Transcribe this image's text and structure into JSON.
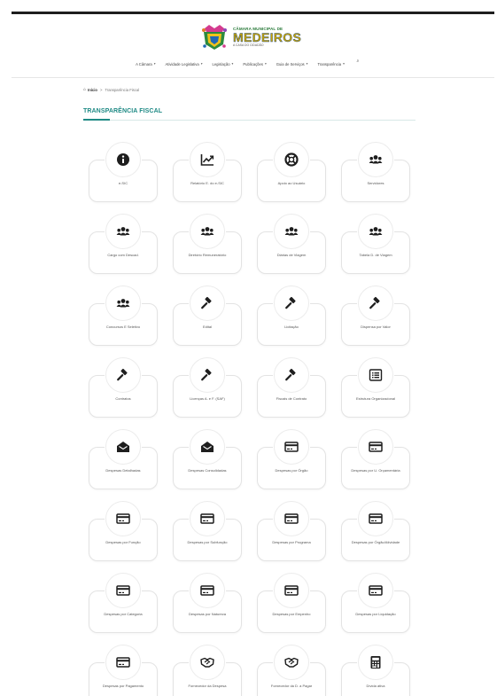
{
  "header": {
    "logo": {
      "subtitle": "CÂMARA MUNICIPAL DE",
      "name": "MEDEIROS",
      "tagline": "A CASA DO CIDADÃO"
    }
  },
  "nav": {
    "items": [
      {
        "label": "A Câmara"
      },
      {
        "label": "Atividade Legislativa"
      },
      {
        "label": "Legislação"
      },
      {
        "label": "Publicações"
      },
      {
        "label": "Guia de Serviços"
      },
      {
        "label": "Transparência"
      }
    ]
  },
  "breadcrumb": {
    "home": "Início",
    "separator": ">",
    "current": "Transparência Fiscal"
  },
  "section": {
    "title": "TRANSPARÊNCIA FISCAL"
  },
  "colors": {
    "accent": "#1f8a85",
    "icon": "#1e1e1e"
  },
  "cards": [
    {
      "label": "e-SIC",
      "icon": "info-icon"
    },
    {
      "label": "Relatório E. do e-SIC",
      "icon": "chart-line-icon"
    },
    {
      "label": "Apoio ao Usuário",
      "icon": "life-ring-icon"
    },
    {
      "label": "Servidores",
      "icon": "users-icon"
    },
    {
      "label": "Cargo com Descad.",
      "icon": "users-icon"
    },
    {
      "label": "Diretório Remuneratório",
      "icon": "users-icon"
    },
    {
      "label": "Diárias de Viagem",
      "icon": "users-icon"
    },
    {
      "label": "Tabela D. de Viagem",
      "icon": "users-icon"
    },
    {
      "label": "Concursos E Seletivo",
      "icon": "users-icon"
    },
    {
      "label": "Edital",
      "icon": "gavel-icon"
    },
    {
      "label": "Licitação",
      "icon": "gavel-icon"
    },
    {
      "label": "Dispensa por Valor",
      "icon": "gavel-icon"
    },
    {
      "label": "Contratos",
      "icon": "gavel-icon"
    },
    {
      "label": "Licenças A. e F. (SAF)",
      "icon": "gavel-icon"
    },
    {
      "label": "Fiscais de Contrato",
      "icon": "gavel-icon"
    },
    {
      "label": "Estrutura Organizacional",
      "icon": "list-alt-icon"
    },
    {
      "label": "Despesas Detalhadas",
      "icon": "envelope-open-icon"
    },
    {
      "label": "Despesas Consolidadas",
      "icon": "envelope-open-icon"
    },
    {
      "label": "Despesas por Órgão",
      "icon": "credit-card-icon"
    },
    {
      "label": "Despesas por U. Orçamentária",
      "icon": "credit-card-icon"
    },
    {
      "label": "Despesas por Função",
      "icon": "credit-card-icon"
    },
    {
      "label": "Despesas por Subfunção",
      "icon": "credit-card-icon"
    },
    {
      "label": "Despesas por Programa",
      "icon": "credit-card-icon"
    },
    {
      "label": "Despesas por Órgão/Atividade",
      "icon": "credit-card-icon"
    },
    {
      "label": "Despesas por Categoria",
      "icon": "credit-card-icon"
    },
    {
      "label": "Despesas por Natureza",
      "icon": "credit-card-icon"
    },
    {
      "label": "Despesas por Empenho",
      "icon": "credit-card-icon"
    },
    {
      "label": "Despesas por Liquidação",
      "icon": "credit-card-icon"
    },
    {
      "label": "Despesas por Pagamento",
      "icon": "credit-card-icon"
    },
    {
      "label": "Fornecedor da Despesa",
      "icon": "handshake-icon"
    },
    {
      "label": "Fornecedor da D. a Pagar",
      "icon": "handshake-icon"
    },
    {
      "label": "Dívida ativa",
      "icon": "calculator-icon"
    }
  ]
}
